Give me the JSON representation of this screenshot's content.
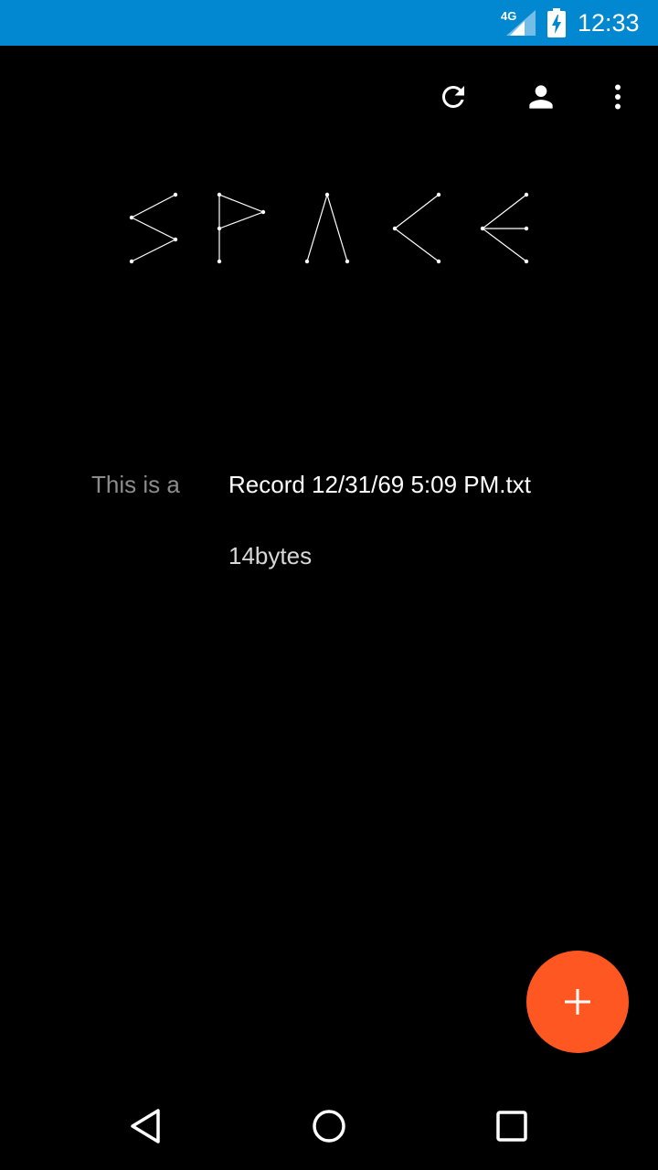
{
  "status_bar": {
    "network_label": "4G",
    "time": "12:33",
    "color": "#0288d1"
  },
  "action_bar": {
    "icons": [
      "refresh-icon",
      "account-icon",
      "overflow-menu-icon"
    ]
  },
  "logo": {
    "text": "SPACE"
  },
  "record": {
    "prefix": "This is a",
    "name": "Record 12/31/69 5:09 PM.txt",
    "size": "14bytes"
  },
  "fab": {
    "icon": "plus-icon",
    "color": "#ff5722"
  },
  "nav_bar": {
    "icons": [
      "back-icon",
      "home-icon",
      "recents-icon"
    ]
  }
}
